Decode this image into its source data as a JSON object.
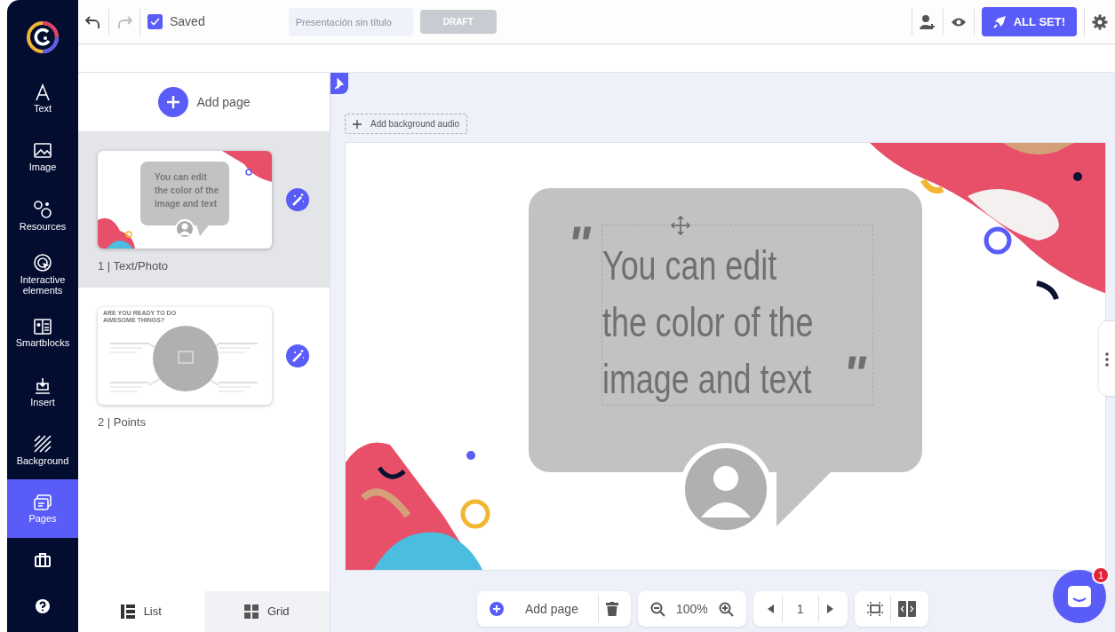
{
  "sidebar": {
    "items": [
      {
        "label": "Text",
        "kind": "text",
        "selected": false
      },
      {
        "label": "Image",
        "kind": "image",
        "selected": false
      },
      {
        "label": "Resources",
        "kind": "resources",
        "selected": false
      },
      {
        "label": "Interactive elements",
        "kind": "interactive",
        "selected": false
      },
      {
        "label": "Smartblocks",
        "kind": "smartblocks",
        "selected": false
      },
      {
        "label": "Insert",
        "kind": "insert",
        "selected": false
      },
      {
        "label": "Background",
        "kind": "background",
        "selected": false
      },
      {
        "label": "Pages",
        "kind": "pages",
        "selected": true
      }
    ]
  },
  "toolbar": {
    "saved": {
      "checked": true,
      "label": "Saved"
    },
    "title_placeholder": "Presentación sin título",
    "status": "DRAFT",
    "publish": "ALL SET!"
  },
  "pages_panel": {
    "add_label": "Add page",
    "pages": [
      {
        "label": "1 | Text/Photo",
        "kind": "quote",
        "selected": true,
        "thumb_lines": [
          "You can edit",
          "the color of the",
          "image and text"
        ]
      },
      {
        "label": "2 | Points",
        "kind": "points",
        "selected": false,
        "thumb_title": "ARE YOU READY TO DO AWESOME THINGS?"
      }
    ],
    "view_tabs": [
      {
        "label": "List",
        "kind": "list",
        "selected": true
      },
      {
        "label": "Grid",
        "kind": "grid",
        "selected": false
      }
    ]
  },
  "canvas": {
    "audio_label": "Add background audio",
    "slide": {
      "quote_open": "\"",
      "lines": [
        "You can edit",
        "the color of the",
        "image and text"
      ],
      "quote_close": "\""
    }
  },
  "bottom_bar": {
    "add_label": "Add page",
    "zoom": "100%",
    "page": "1"
  },
  "chat": {
    "badge": "1"
  }
}
